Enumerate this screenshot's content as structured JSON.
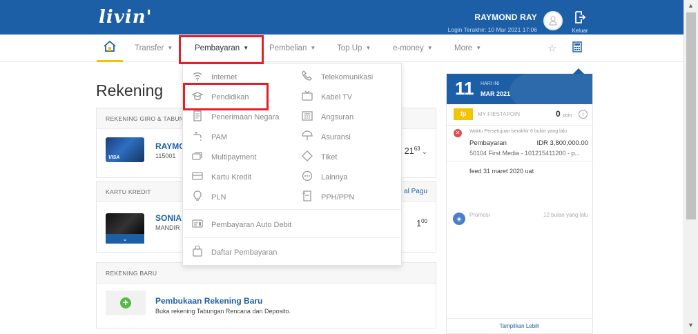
{
  "header": {
    "logo": "livin'",
    "user_name": "RAYMOND RAY",
    "last_login": "Login Terakhir: 10 Mar 2021 17:06",
    "logout_label": "Keluar"
  },
  "nav": {
    "items": [
      {
        "label": "Transfer"
      },
      {
        "label": "Pembayaran"
      },
      {
        "label": "Pembelian"
      },
      {
        "label": "Top Up"
      },
      {
        "label": "e-money"
      },
      {
        "label": "More"
      }
    ],
    "active": "Pembayaran"
  },
  "page": {
    "title": "Rekening"
  },
  "accounts": {
    "section1_header": "REKENING GIRO & TABUNG",
    "acct1_name": "RAYMO",
    "acct1_number": "115001",
    "acct1_amount": "21",
    "acct1_amount_cents": "63",
    "section2_header": "KARTU KREDIT",
    "section2_link": "al Pagu",
    "card_name": "SONIA",
    "card_bank": "MANDIR",
    "card_amount": "1",
    "card_amount_cents": "00",
    "section3_header": "REKENING BARU",
    "new_title": "Pembukaan Rekening Baru",
    "new_sub": "Buka rekening Tabungan Rencana dan Deposito."
  },
  "dropdown": {
    "left_items": [
      {
        "label": "Internet",
        "icon": "wifi-icon"
      },
      {
        "label": "Pendidikan",
        "icon": "graduation-cap-icon"
      },
      {
        "label": "Penerimaan Negara",
        "icon": "document-icon"
      },
      {
        "label": "PAM",
        "icon": "water-tap-icon"
      },
      {
        "label": "Multipayment",
        "icon": "cards-icon"
      },
      {
        "label": "Kartu Kredit",
        "icon": "credit-card-icon"
      },
      {
        "label": "PLN",
        "icon": "lightbulb-icon"
      }
    ],
    "right_items": [
      {
        "label": "Telekomunikasi",
        "icon": "phone-icon"
      },
      {
        "label": "Kabel TV",
        "icon": "tv-icon"
      },
      {
        "label": "Angsuran",
        "icon": "calculator-icon"
      },
      {
        "label": "Asuransi",
        "icon": "umbrella-icon"
      },
      {
        "label": "Tiket",
        "icon": "ticket-icon"
      },
      {
        "label": "Lainnya",
        "icon": "more-dots-icon"
      },
      {
        "label": "PPH/PPN",
        "icon": "receipt-icon"
      }
    ],
    "auto_debit": "Pembayaran Auto Debit",
    "daftar": "Daftar Pembayaran",
    "highlighted": "Pendidikan"
  },
  "panel": {
    "day": "11",
    "today_label": "HARI INI",
    "month": "MAR 2021",
    "fiesta_badge": "fp",
    "fiesta_label": "MY FIESTAPOIN",
    "poin_value": "0",
    "poin_unit": "poin",
    "feed_time": "Waktu Persetujuan berakhir  6 bulan yang lalu",
    "feed_title": "Pembayaran",
    "feed_amount": "IDR 3,800,000.00",
    "feed_desc": "50104 First Media - 101215411200 - p...",
    "feed_note": "feed 31 maret 2020 uat",
    "promo_label": "Promosi",
    "promo_time": "12 bulan yang lalu",
    "show_more": "Tampilkan Lebih"
  },
  "colors": {
    "brand_blue": "#1d5fa6",
    "accent_yellow": "#f5c400",
    "highlight_red": "#e41e26"
  }
}
